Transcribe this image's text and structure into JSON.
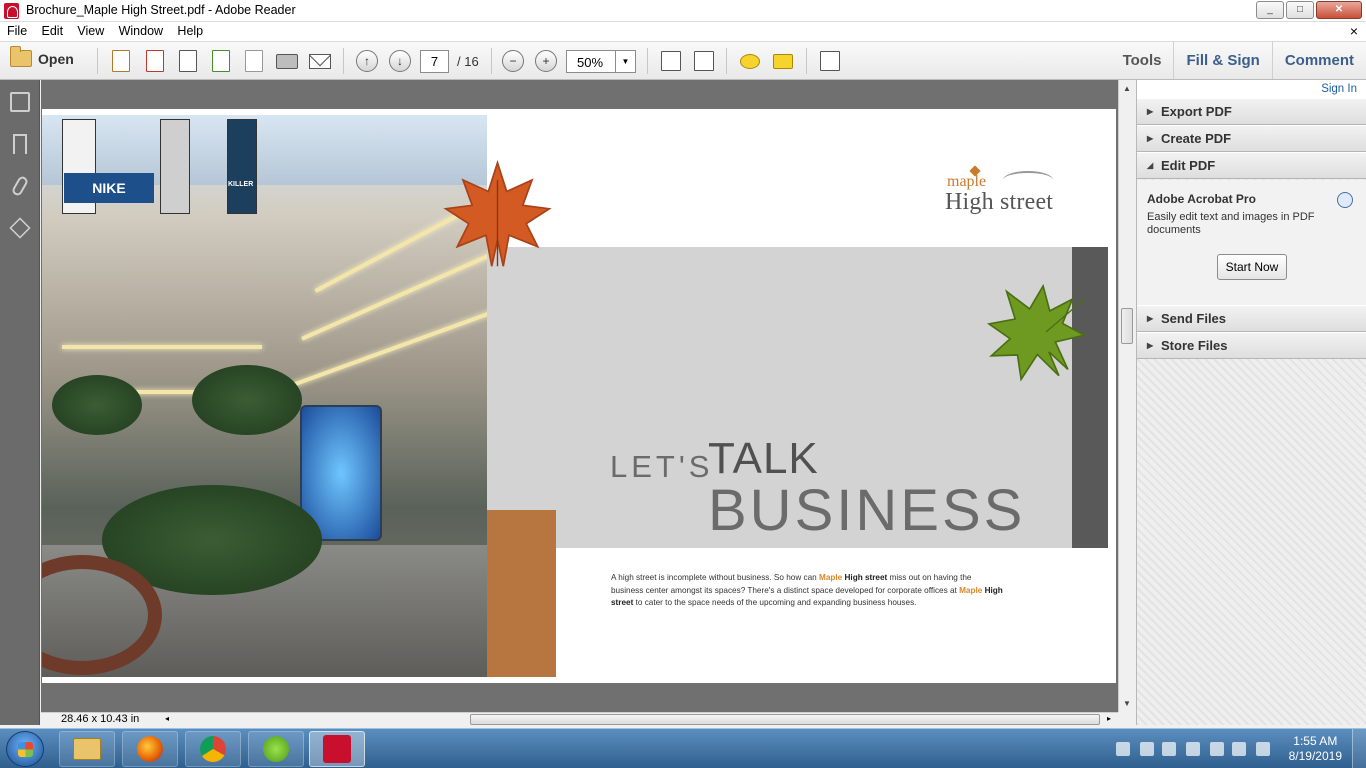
{
  "window": {
    "title": "Brochure_Maple High Street.pdf - Adobe Reader",
    "controls": [
      "_",
      "□",
      "✕"
    ]
  },
  "menu": {
    "items": [
      "File",
      "Edit",
      "View",
      "Window",
      "Help"
    ],
    "close_glyph": "×"
  },
  "toolbar": {
    "open_label": "Open",
    "page_current": "7",
    "page_total": "/ 16",
    "zoom": "50%",
    "zoom_arrow": "▼",
    "prev_glyph": "↑",
    "next_glyph": "↓",
    "zoom_out_glyph": "−",
    "zoom_in_glyph": "+",
    "tools_label": "Tools",
    "fill_sign_label": "Fill & Sign",
    "comment_label": "Comment"
  },
  "document": {
    "logo_top": "maple",
    "logo_bottom": "High street",
    "heading_lets": "LET'S",
    "heading_talk": "TALK",
    "heading_business": "BUSINESS",
    "body_intro": "A high street is incomplete without business. So how can",
    "brand_maple": "Maple",
    "brand_highstreet": "High street",
    "body_mid": "miss out on having the business center amongst its spaces? There's a distinct space developed for corporate offices at",
    "body_end": "to cater to the space needs of the upcoming and expanding business houses.",
    "photo_text_nike": "NIKE",
    "photo_text_killer": "KILLER"
  },
  "statusbar": {
    "dimensions": "28.46 x 10.43 in",
    "scroll_left": "◂",
    "scroll_right": "▸",
    "scroll_grip": "III"
  },
  "scrollbar": {
    "up": "▲",
    "down": "▼",
    "grip": "≡"
  },
  "rightpane": {
    "signin": "Sign In",
    "expand_glyph": "▶",
    "collapse_glyph": "◢",
    "sections_top": [
      "Export PDF",
      "Create PDF",
      "Edit PDF"
    ],
    "edit_title": "Adobe Acrobat Pro",
    "edit_desc": "Easily edit text and images in PDF documents",
    "start_now": "Start Now",
    "sections_bottom": [
      "Send Files",
      "Store Files"
    ]
  },
  "taskbar": {
    "apps": [
      "file-explorer",
      "firefox",
      "chrome",
      "utorrent",
      "adobe-reader"
    ],
    "time": "1:55 AM",
    "date": "8/19/2019"
  },
  "colors": {
    "accent_blue": "#3b5f8a",
    "brand_orange": "#b7763f",
    "maple_gold": "#d9882b",
    "panel_grey": "#d3d3d3",
    "strip_dark": "#595959"
  }
}
